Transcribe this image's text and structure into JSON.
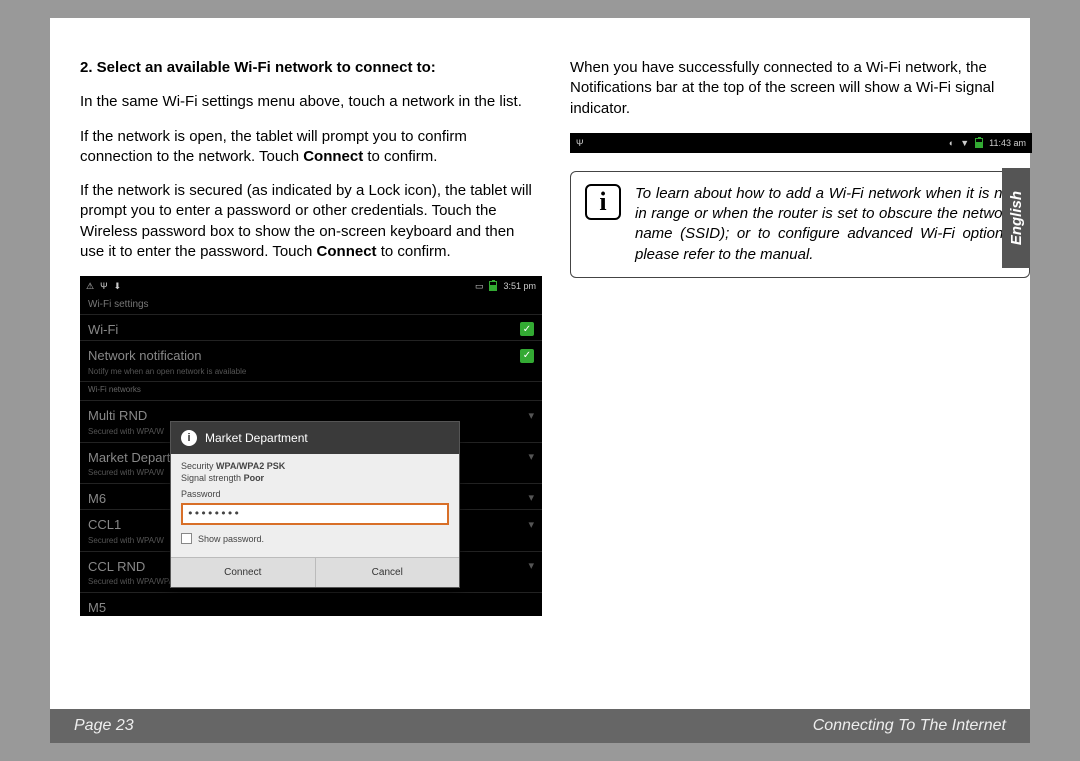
{
  "heading": "2.   Select an available Wi-Fi network to connect to:",
  "para1": "In the same Wi-Fi settings menu above, touch a network in the list.",
  "para2a": "If the network is open, the tablet will prompt you to confirm connection to the network. Touch ",
  "para2b": "Connect",
  "para2c": " to confirm.",
  "para3a": "If the network is secured (as indicated by a Lock icon), the tablet will prompt you to enter a password or other credentials.  Touch the Wireless password box to show the on-screen keyboard and then use it to enter the password. Touch ",
  "para3b": "Connect",
  "para3c": " to confirm.",
  "right1": "When you have successfully connected to a Wi-Fi network, the Notifications bar at the top of the screen will show a Wi-Fi signal indicator.",
  "infobox": "To learn about how to add a Wi-Fi network when it is not in range or when the router is set to obscure the network name (SSID); or to configure advanced Wi-Fi options, please refer to the manual.",
  "side_tab": "English",
  "footer_left": "Page 23",
  "footer_right": "Connecting To The Internet",
  "shot1": {
    "time": "3:51 pm",
    "title": "Wi-Fi settings",
    "wifi_label": "Wi-Fi",
    "notif_label": "Network notification",
    "notif_sub": "Notify me when an open network is available",
    "section": "Wi-Fi networks",
    "networks": [
      "Multi RND",
      "Market Depart",
      "M6",
      "CCL1",
      "CCL RND",
      "M5"
    ],
    "secured": "Secured with WPA/WPA2 PSK",
    "secured_short": "Secured with WPA/W",
    "dialog": {
      "title": "Market Department",
      "sec_lbl": "Security",
      "sec_val": "WPA/WPA2 PSK",
      "sig_lbl": "Signal strength",
      "sig_val": "Poor",
      "pw_lbl": "Password",
      "pw_val": "••••••••",
      "show_pw": "Show password.",
      "connect": "Connect",
      "cancel": "Cancel"
    }
  },
  "shot2": {
    "time": "11:43 am"
  }
}
